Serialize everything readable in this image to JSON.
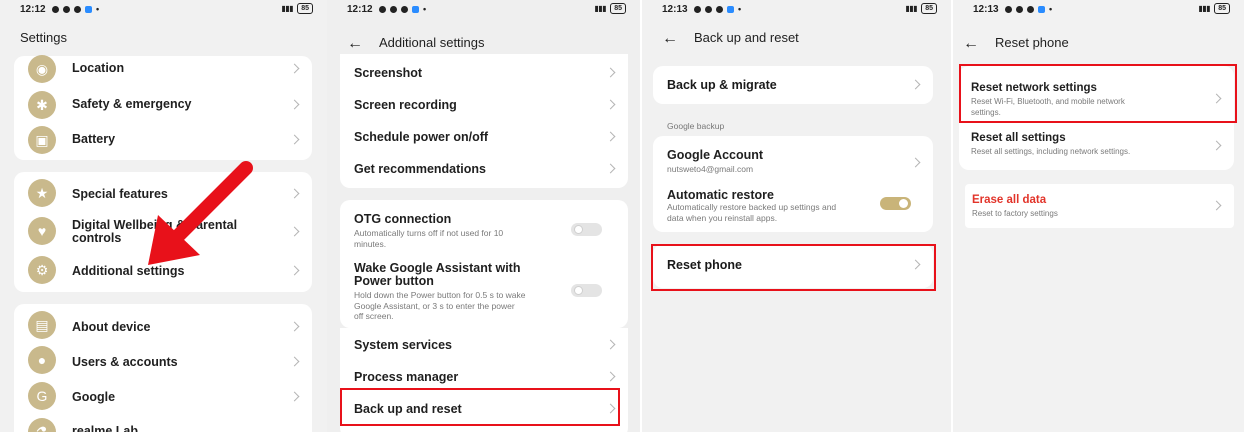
{
  "panel1": {
    "status": {
      "time": "12:12",
      "battery": "85"
    },
    "title": "Settings",
    "group1": [
      {
        "label": "Location",
        "icon": "location-icon"
      },
      {
        "label": "Safety & emergency",
        "icon": "asterisk-icon"
      },
      {
        "label": "Battery",
        "icon": "battery-icon"
      }
    ],
    "group2": [
      {
        "label": "Special features",
        "icon": "star-icon"
      },
      {
        "label": "Digital Wellbeing & parental\ncontrols",
        "icon": "wellbeing-icon"
      },
      {
        "label": "Additional settings",
        "icon": "gear-icon"
      }
    ],
    "group3": [
      {
        "label": "About device",
        "icon": "device-icon"
      },
      {
        "label": "Users & accounts",
        "icon": "user-icon"
      },
      {
        "label": "Google",
        "icon": "google-icon"
      },
      {
        "label": "realme Lab",
        "icon": "lab-icon"
      }
    ]
  },
  "panel2": {
    "status": {
      "time": "12:12",
      "battery": "85"
    },
    "title": "Additional settings",
    "group1": [
      "Screenshot",
      "Screen recording",
      "Schedule power on/off",
      "Get recommendations"
    ],
    "otg": {
      "label": "OTG connection",
      "desc": "Automatically turns off if not used for 10\nminutes."
    },
    "wake": {
      "label": "Wake Google Assistant with\nPower button",
      "desc": "Hold down the Power button for 0.5 s to wake\nGoogle Assistant, or 3 s to enter the power\noff screen."
    },
    "group3": [
      "System services",
      "Process manager",
      "Back up and reset"
    ]
  },
  "panel3": {
    "status": {
      "time": "12:13",
      "battery": "85"
    },
    "title": "Back up and reset",
    "backup_migrate": "Back up & migrate",
    "google_backup_head": "Google backup",
    "google_account": {
      "label": "Google Account",
      "desc": "nutsweto4@gmail.com"
    },
    "auto_restore": {
      "label": "Automatic restore",
      "desc": "Automatically restore backed up settings and\ndata when you reinstall apps."
    },
    "reset_phone": "Reset phone"
  },
  "panel4": {
    "status": {
      "time": "12:13",
      "battery": "85"
    },
    "title": "Reset phone",
    "network": {
      "label": "Reset network settings",
      "desc": "Reset Wi-Fi, Bluetooth, and mobile network\nsettings."
    },
    "all": {
      "label": "Reset all settings",
      "desc": "Reset all settings, including network settings."
    },
    "erase": {
      "label": "Erase all data",
      "desc": "Reset to factory settings"
    }
  },
  "colors": {
    "highlight": "#e8111a",
    "accent": "#c9b479",
    "danger": "#e2342a"
  }
}
